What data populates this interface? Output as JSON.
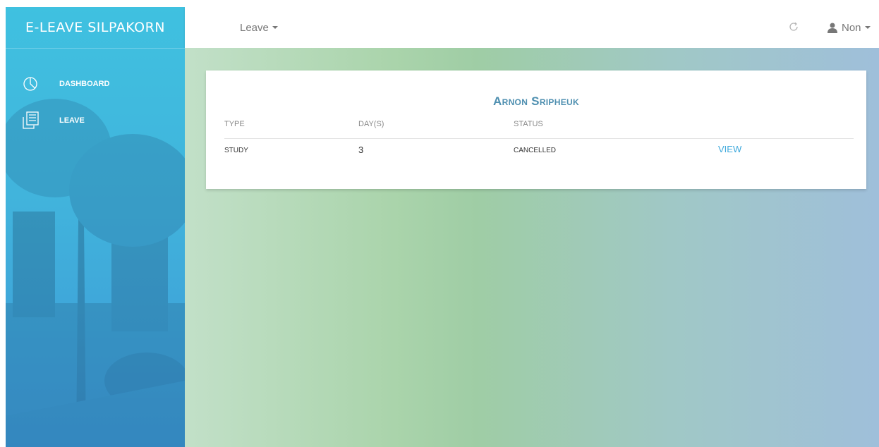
{
  "sidebar": {
    "brand": "E-LEAVE SILPAKORN",
    "items": [
      {
        "label": "DASHBOARD",
        "icon": "pie-chart-icon"
      },
      {
        "label": "LEAVE",
        "icon": "document-list-icon"
      }
    ]
  },
  "topbar": {
    "menu_label": "Leave",
    "refresh_icon": "refresh-icon",
    "user_label": "Non",
    "user_icon": "user-icon"
  },
  "card": {
    "title": "Arnon Sripheuk",
    "columns": [
      "TYPE",
      "DAY(S)",
      "STATUS"
    ],
    "rows": [
      {
        "type": "STUDY",
        "days": "3",
        "status": "CANCELLED",
        "action": "VIEW"
      }
    ]
  },
  "colors": {
    "sidebar_top": "#3fc1e0",
    "sidebar_bottom": "#3c97d6",
    "title_blue": "#4e8fb0",
    "link_blue": "#3fa9dc"
  }
}
